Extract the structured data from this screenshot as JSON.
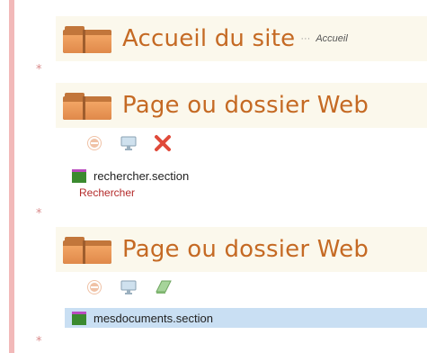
{
  "asterisk": "*",
  "home": {
    "title": "Accueil du site",
    "dots": "···",
    "subtitle": "Accueil"
  },
  "blocks": [
    {
      "title": "Page ou dossier Web",
      "section": "rechercher.section",
      "link": "Rechercher",
      "third_tool_icon": "delete-x-icon"
    },
    {
      "title": "Page ou dossier Web",
      "section": "mesdocuments.section",
      "link": "",
      "third_tool_icon": "green-book-icon"
    }
  ],
  "colors": {
    "accent": "#c56a24",
    "left_bar": "#f2b9b9",
    "selected_row": "#c9dff3",
    "link": "#b42b2b"
  }
}
